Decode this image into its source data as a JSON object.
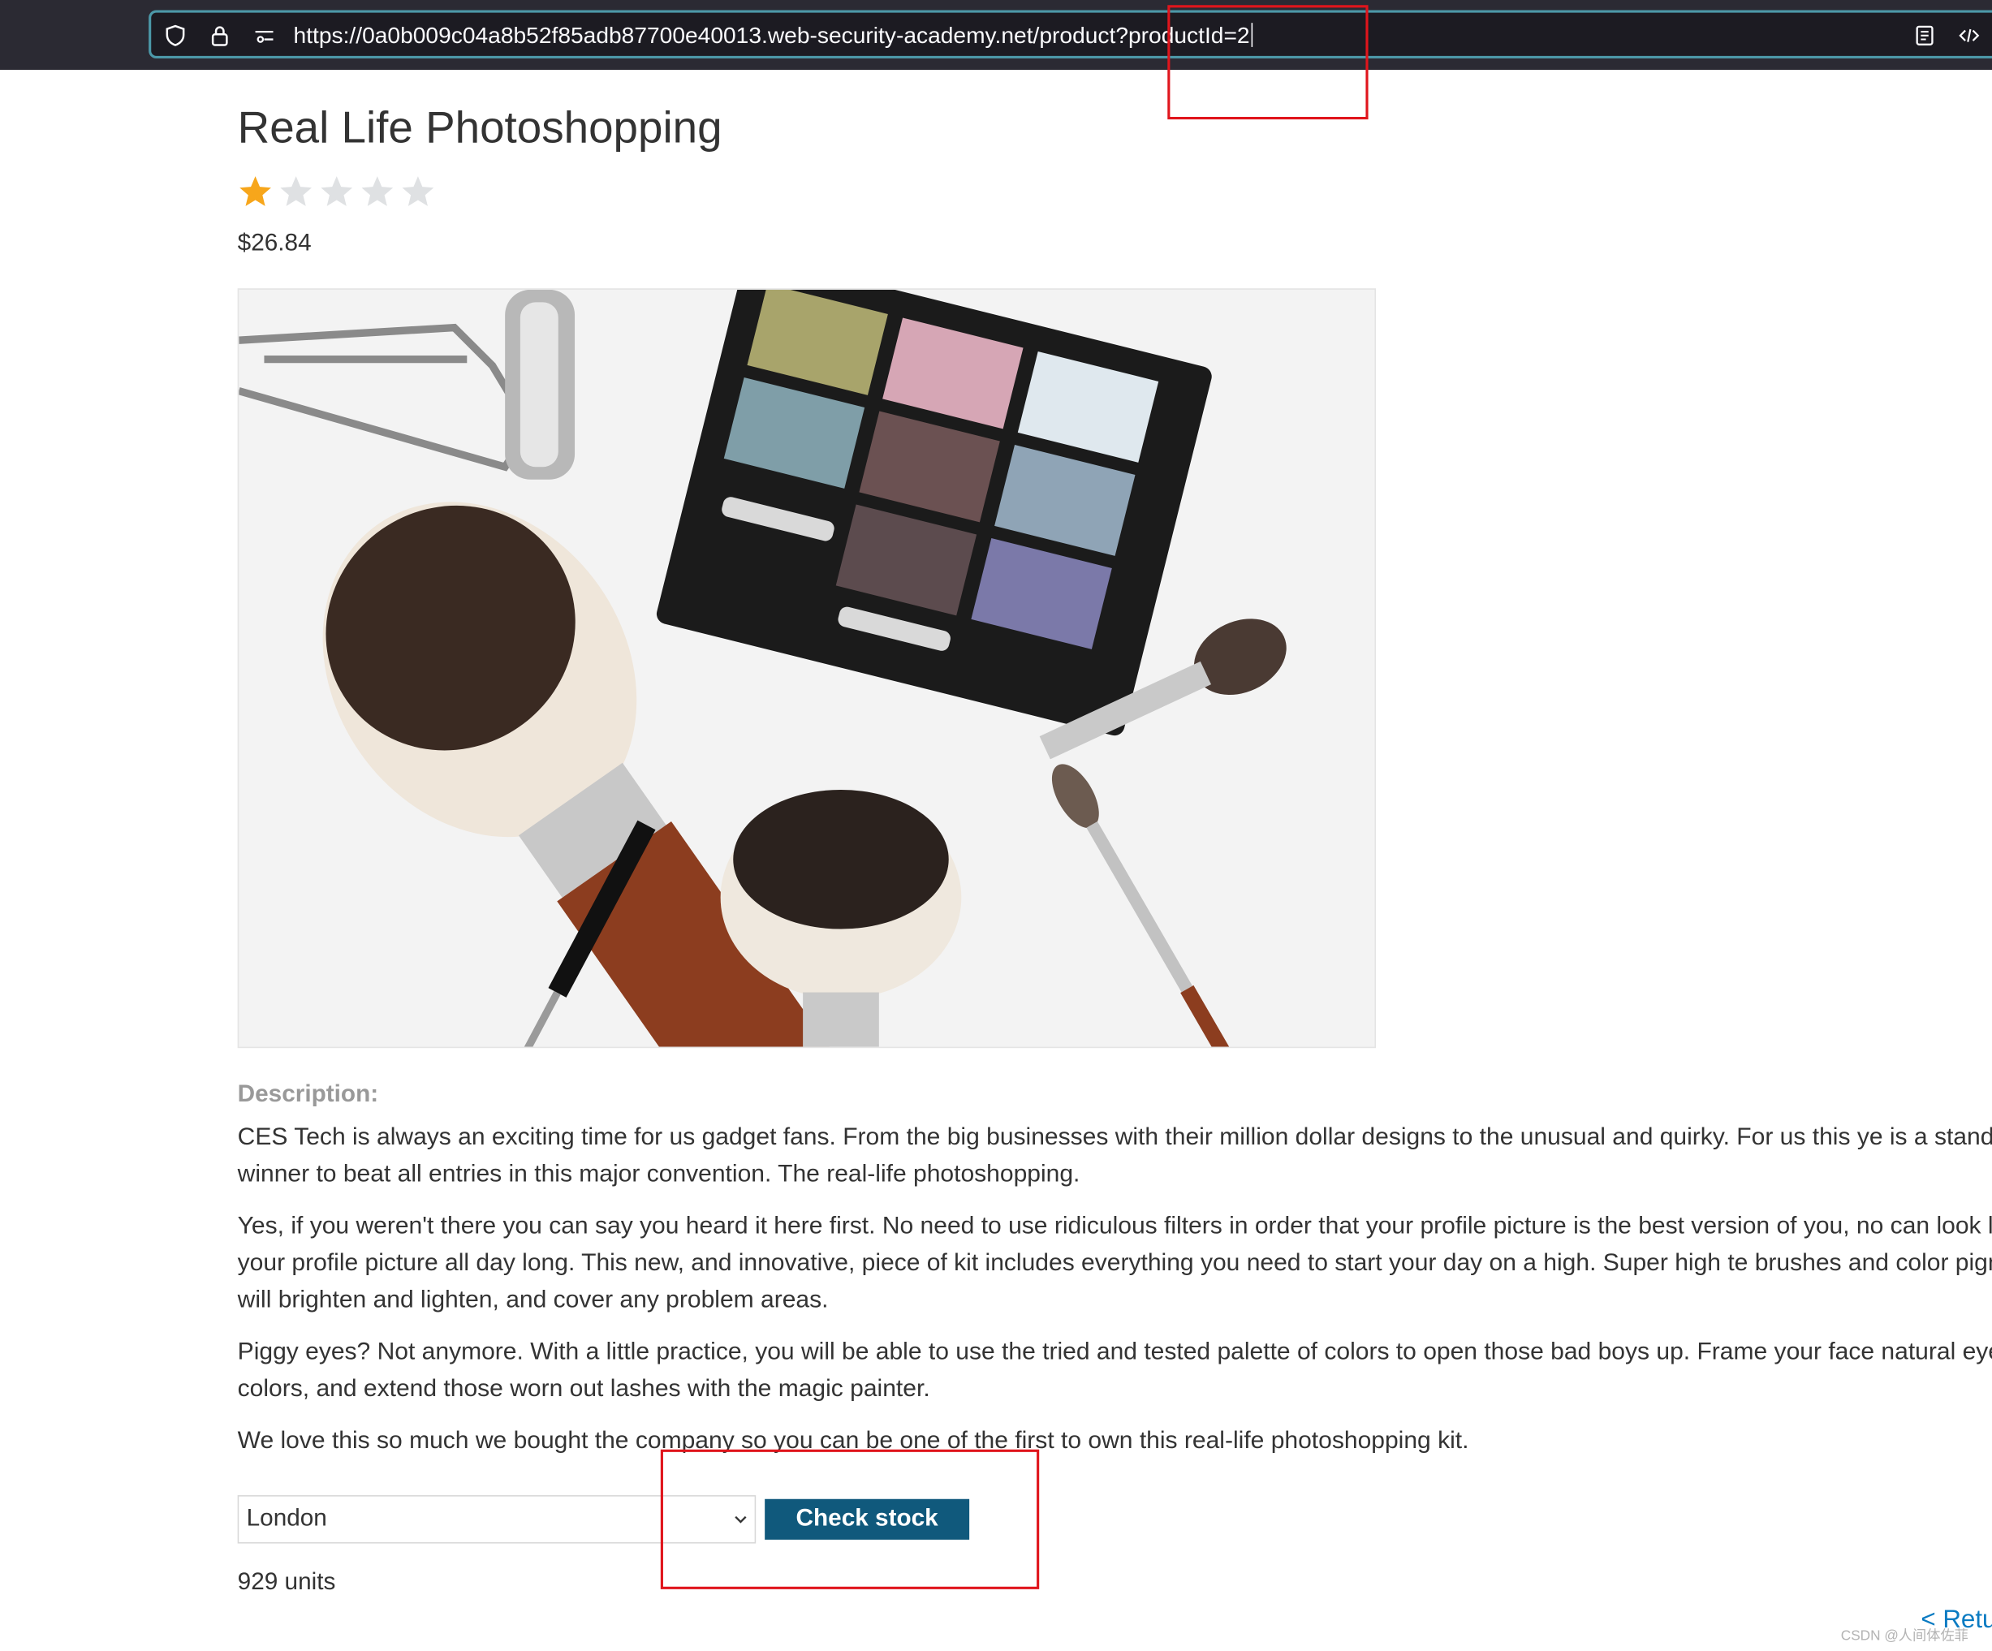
{
  "browser": {
    "url": "https://0a0b009c04a8b52f85adb87700e40013.web-security-academy.net/product?productId=2",
    "icons": [
      "shield-icon",
      "lock-icon",
      "site-permissions-icon",
      "reader-view-icon",
      "code-icon"
    ]
  },
  "product": {
    "title": "Real Life Photoshopping",
    "rating": {
      "value": 1,
      "max": 5
    },
    "price": "$26.84",
    "image": "makeup brushes, eyelash curler and eyeshadow palette",
    "description_label": "Description:",
    "description": [
      "CES Tech is always an exciting time for us gadget fans. From the big businesses with their million dollar designs to the unusual and quirky. For us this ye is a stand out winner to beat all entries in this major convention. The real-life photoshopping.",
      "Yes, if you weren't there you can say you heard it here first. No need to use ridiculous filters in order that your profile picture is the best version of you, no can look like your profile picture all day long. This new, and innovative, piece of kit includes everything you need to start your day on a high. Super high te brushes and color pigments will brighten and lighten, and cover any problem areas.",
      "Piggy eyes? Not anymore. With a little practice, you will be able to use the tried and tested palette of colors to open those bad boys up. Frame your face natural eyebrow colors, and extend those worn out lashes with the magic painter.",
      "We love this so much we bought the company so you can be one of the first to own this real-life photoshopping kit."
    ]
  },
  "stock_check": {
    "store_selected": "London",
    "button_label": "Check stock",
    "result": "929 units"
  },
  "footer": {
    "return_link": "< Retu",
    "watermark": "CSDN @人间体佐菲"
  },
  "colors": {
    "accent_button": "#10597c",
    "link": "#0a7bc2",
    "star_filled": "#f7a61b",
    "star_empty": "#dddddd",
    "annotation": "#e0151c",
    "urlbar_border": "#4c98a8"
  }
}
